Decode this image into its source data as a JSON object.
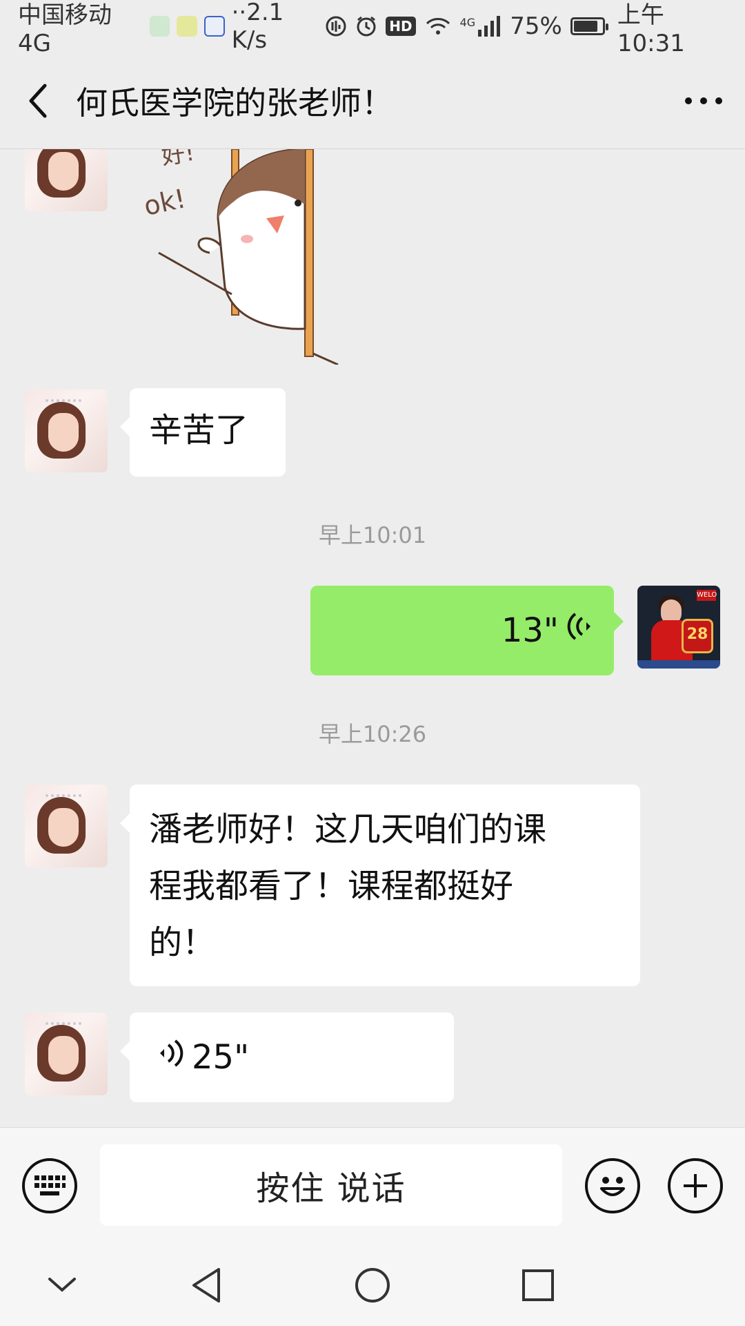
{
  "status_bar": {
    "carrier": "中国移动4G",
    "speed": "··2.1 K/s",
    "network": "4G",
    "battery": "75%",
    "time": "上午10:31"
  },
  "header": {
    "title": "何氏医学院的张老师！",
    "back_icon": "chevron-left-icon",
    "more_icon": "more-icon"
  },
  "messages": [
    {
      "side": "left",
      "type": "sticker",
      "sticker_text": [
        "好!",
        "ok!"
      ]
    },
    {
      "side": "left",
      "type": "text",
      "text": "辛苦了"
    },
    {
      "type": "time",
      "text": "早上10:01"
    },
    {
      "side": "right",
      "type": "voice",
      "duration": "13\""
    },
    {
      "type": "time",
      "text": "早上10:26"
    },
    {
      "side": "left",
      "type": "text",
      "lines": [
        "潘老师好！这几天咱们的课",
        "程我都看了！课程都挺好",
        "的！"
      ]
    },
    {
      "side": "left",
      "type": "voice",
      "duration": "25\""
    }
  ],
  "input_bar": {
    "hold_to_talk": "按住 说话",
    "keyboard_icon": "keyboard-icon",
    "emoji_icon": "emoji-icon",
    "plus_icon": "plus-icon"
  },
  "nav_bar": {
    "icons": [
      "collapse-icon",
      "back-triangle-icon",
      "home-circle-icon",
      "recents-square-icon"
    ]
  },
  "avatar_badge": "28"
}
